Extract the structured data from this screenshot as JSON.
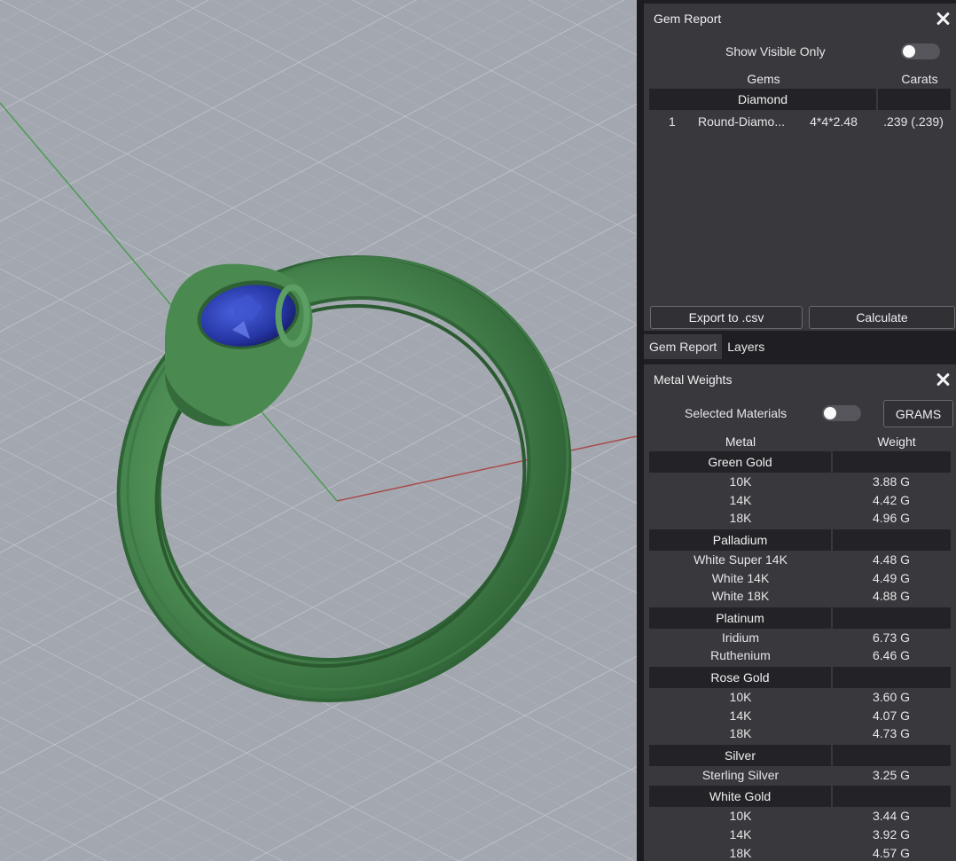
{
  "gem_report": {
    "title": "Gem Report",
    "show_visible_only_label": "Show Visible Only",
    "show_visible_only_on": false,
    "columns": {
      "gems": "Gems",
      "carats": "Carats"
    },
    "groups": [
      {
        "name": "Diamond",
        "rows": [
          {
            "index": "1",
            "name": "Round-Diamo...",
            "size": "4*4*2.48",
            "carats": ".239 (.239)"
          }
        ]
      }
    ],
    "export_label": "Export to .csv",
    "calculate_label": "Calculate"
  },
  "tabs": [
    {
      "label": "Gem Report",
      "active": true
    },
    {
      "label": "Layers",
      "active": false
    }
  ],
  "metal_weights": {
    "title": "Metal Weights",
    "selected_materials_label": "Selected Materials",
    "selected_materials_on": false,
    "units_label": "GRAMS",
    "columns": {
      "metal": "Metal",
      "weight": "Weight"
    },
    "groups": [
      {
        "name": "Green Gold",
        "rows": [
          {
            "name": "10K",
            "weight": "3.88 G"
          },
          {
            "name": "14K",
            "weight": "4.42 G"
          },
          {
            "name": "18K",
            "weight": "4.96 G"
          }
        ]
      },
      {
        "name": "Palladium",
        "rows": [
          {
            "name": "White Super 14K",
            "weight": "4.48 G"
          },
          {
            "name": "White 14K",
            "weight": "4.49 G"
          },
          {
            "name": "White 18K",
            "weight": "4.88 G"
          }
        ]
      },
      {
        "name": "Platinum",
        "rows": [
          {
            "name": "Iridium",
            "weight": "6.73 G"
          },
          {
            "name": "Ruthenium",
            "weight": "6.46 G"
          }
        ]
      },
      {
        "name": "Rose Gold",
        "rows": [
          {
            "name": "10K",
            "weight": "3.60 G"
          },
          {
            "name": "14K",
            "weight": "4.07 G"
          },
          {
            "name": "18K",
            "weight": "4.73 G"
          }
        ]
      },
      {
        "name": "Silver",
        "rows": [
          {
            "name": "Sterling Silver",
            "weight": "3.25 G"
          }
        ]
      },
      {
        "name": "White Gold",
        "rows": [
          {
            "name": "10K",
            "weight": "3.44 G"
          },
          {
            "name": "14K",
            "weight": "3.92 G"
          },
          {
            "name": "18K",
            "weight": "4.57 G"
          }
        ]
      }
    ]
  },
  "colors": {
    "viewport_bg": "#a3a8b0",
    "grid_line": "#b4b8bf",
    "panel_bg": "#38383d",
    "group_bg": "#232327",
    "ring_metal": "#4f8f56",
    "gem": "#2a3fb0",
    "x_axis": "#a84a4a",
    "y_axis": "#4d9a52"
  }
}
